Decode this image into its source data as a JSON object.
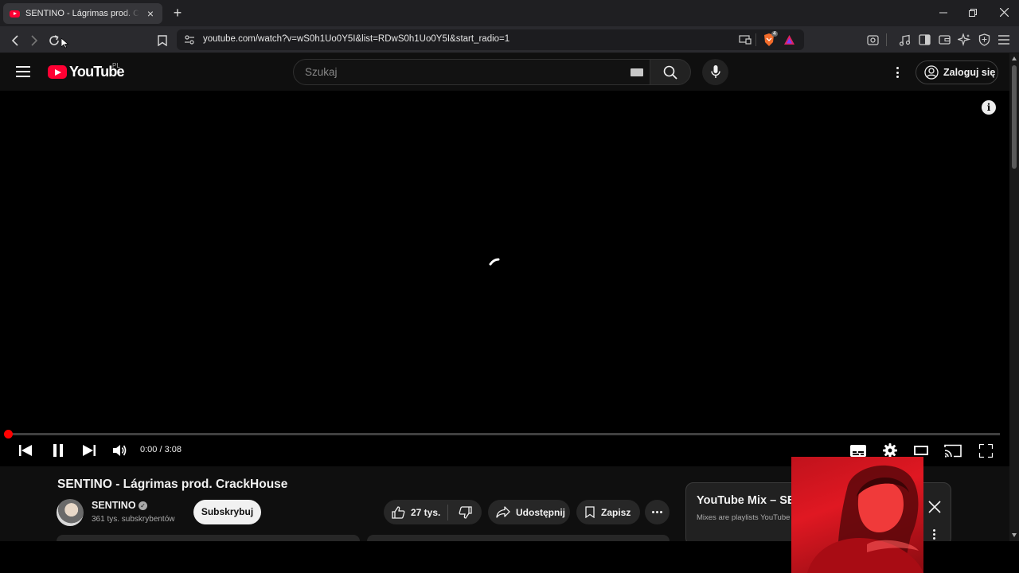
{
  "browser": {
    "tab_title": "SENTINO - Lágrimas prod. CrackHouse",
    "new_tab": "+",
    "tab_close": "×",
    "url": "youtube.com/watch?v=wS0h1Uo0Y5I&list=RDwS0h1Uo0Y5I&start_radio=1",
    "extension_badge": "4"
  },
  "youtube": {
    "logo_text": "YouTube",
    "country_code": "PL",
    "search_placeholder": "Szukaj",
    "signin_label": "Zaloguj się"
  },
  "player": {
    "time": "0:00 / 3:08",
    "progress_fraction": 0.0,
    "info_glyph": "i"
  },
  "video": {
    "title": "SENTINO - Lágrimas prod. CrackHouse",
    "channel_name": "SENTINO",
    "subscribers": "361 tys. subskrybentów",
    "subscribe_label": "Subskrybuj",
    "likes": "27 tys.",
    "share_label": "Udostępnij",
    "save_label": "Zapisz"
  },
  "mix": {
    "title": "YouTube Mix – SENTINO",
    "subtitle": "Mixes are playlists YouTube makes for you"
  },
  "colors": {
    "brand_red": "#ff0033",
    "progress_red": "#ff0000",
    "page_bg": "#0f0f0f"
  }
}
